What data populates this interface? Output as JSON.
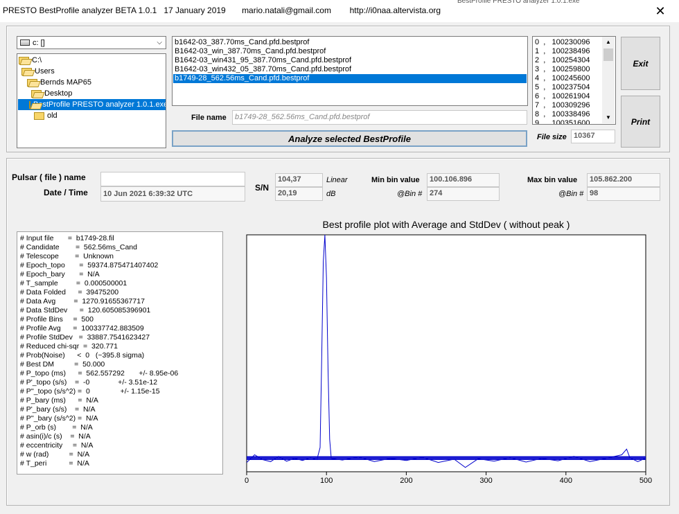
{
  "window": {
    "title": "PRESTO BestProfile analyzer BETA 1.0.1   17 January 2019       mario.natali@gmail.com        http://i0naa.altervista.org",
    "close_glyph": "✕",
    "background_partial": "BestProfile PRESTO analyzer 1.0.1.exe"
  },
  "drive": {
    "value": "c: []",
    "arrow": "⌵"
  },
  "directories": [
    {
      "label": "C:\\",
      "selected": false,
      "open": true
    },
    {
      "label": "Users",
      "selected": false,
      "open": true
    },
    {
      "label": "Bernds MAP65",
      "selected": false,
      "open": true
    },
    {
      "label": "Desktop",
      "selected": false,
      "open": true
    },
    {
      "label": "BestProfile PRESTO analyzer 1.0.1.exe",
      "selected": true,
      "open": true
    },
    {
      "label": "old",
      "selected": false,
      "open": false
    }
  ],
  "files": [
    {
      "name": "b1642-03_387.70ms_Cand.pfd.bestprof",
      "selected": false
    },
    {
      "name": "B1642-03_win_387.70ms_Cand.pfd.bestprof",
      "selected": false
    },
    {
      "name": "B1642-03_win431_95_387.70ms_Cand.pfd.bestprof",
      "selected": false
    },
    {
      "name": "B1642-03_win432_05_387.70ms_Cand.pfd.bestprof",
      "selected": false
    },
    {
      "name": "b1749-28_562.56ms_Cand.pfd.bestprof",
      "selected": true
    }
  ],
  "file_name": {
    "label": "File name",
    "value": "b1749-28_562.56ms_Cand.pfd.bestprof"
  },
  "analyze_button": "Analyze selected BestProfile",
  "values_list": [
    "0  ,   100230096",
    "1  ,   100238496",
    "2  ,   100254304",
    "3  ,   100259800",
    "4  ,   100245600",
    "5  ,   100237504",
    "6  ,   100261904",
    "7  ,   100309296",
    "8  ,   100338496",
    "9  ,   100351600"
  ],
  "file_size": {
    "label": "File size",
    "value": "10367"
  },
  "buttons": {
    "exit": "Exit",
    "print": "Print"
  },
  "pulsar": {
    "label": "Pulsar ( file ) name",
    "value": ""
  },
  "date_time": {
    "label": "Date / Time",
    "value": "10 Jun 2021      6:39:32  UTC"
  },
  "sn": {
    "label": "S/N",
    "linear_value": "104,37",
    "linear_label": "Linear",
    "db_value": "20,19",
    "db_label": "dB"
  },
  "min_bin": {
    "label": "Min bin value",
    "value": "100.106.896",
    "bin_label": "@Bin #",
    "bin": "274"
  },
  "max_bin": {
    "label": "Max bin value",
    "value": "105.862.200",
    "bin_label": "@Bin #",
    "bin": "98"
  },
  "params": [
    "# Input file       =  b1749-28.fil",
    "# Candidate        =  562.56ms_Cand",
    "# Telescope        =  Unknown",
    "# Epoch_topo       =  59374.875471407402",
    "# Epoch_bary       =  N/A",
    "# T_sample         =  0.000500001",
    "# Data Folded      =  39475200",
    "# Data Avg         =  1270.91655367717",
    "# Data StdDev      =  120.605085396901",
    "# Profile Bins     =  500",
    "# Profile Avg      =  100337742.883509",
    "# Profile StdDev   =  33887.7541623427",
    "# Reduced chi-sqr  =  320.771",
    "# Prob(Noise)      <  0   (~395.8 sigma)",
    "# Best DM          =  50.000",
    "# P_topo (ms)      =  562.557292       +/- 8.95e-06",
    "# P'_topo (s/s)    =  -0              +/- 3.51e-12",
    "# P''_topo (s/s^2) =  0               +/- 1.15e-15",
    "# P_bary (ms)      =  N/A",
    "# P'_bary (s/s)    =  N/A",
    "# P''_bary (s/s^2) =  N/A",
    "# P_orb (s)        =  N/A",
    "# asin(i)/c (s)    =  N/A",
    "# eccentricity     =  N/A",
    "# w (rad)          =  N/A",
    "# T_peri           =  N/A"
  ],
  "chart_data": {
    "type": "line",
    "title": "Best profile plot with  Average and StdDev ( without peak )",
    "xlim": [
      0,
      500
    ],
    "x_ticks": [
      0,
      100,
      200,
      300,
      400,
      500
    ],
    "ylim": [
      100000000,
      105862200
    ],
    "line_color": "#0000cc",
    "series": [
      {
        "values_sparse": [
          [
            0,
            100230096
          ],
          [
            10,
            100420000
          ],
          [
            20,
            100300000
          ],
          [
            30,
            100250000
          ],
          [
            40,
            100380000
          ],
          [
            50,
            100260000
          ],
          [
            60,
            100330000
          ],
          [
            70,
            100280000
          ],
          [
            80,
            100350000
          ],
          [
            88,
            100300000
          ],
          [
            92,
            100600000
          ],
          [
            94,
            102800000
          ],
          [
            96,
            105200000
          ],
          [
            98,
            105862200
          ],
          [
            100,
            104800000
          ],
          [
            102,
            102500000
          ],
          [
            104,
            100800000
          ],
          [
            106,
            100330000
          ],
          [
            120,
            100290000
          ],
          [
            140,
            100370000
          ],
          [
            160,
            100250000
          ],
          [
            180,
            100330000
          ],
          [
            200,
            100280000
          ],
          [
            220,
            100360000
          ],
          [
            240,
            100230000
          ],
          [
            260,
            100310000
          ],
          [
            274,
            100106896
          ],
          [
            290,
            100320000
          ],
          [
            310,
            100260000
          ],
          [
            330,
            100350000
          ],
          [
            350,
            100240000
          ],
          [
            370,
            100330000
          ],
          [
            390,
            100270000
          ],
          [
            410,
            100380000
          ],
          [
            430,
            100250000
          ],
          [
            450,
            100330000
          ],
          [
            470,
            100420000
          ],
          [
            476,
            100560000
          ],
          [
            480,
            100350000
          ],
          [
            490,
            100250000
          ],
          [
            499,
            100330000
          ]
        ]
      }
    ],
    "average": 100337742.883509,
    "stddev": 33887.7541623427
  }
}
